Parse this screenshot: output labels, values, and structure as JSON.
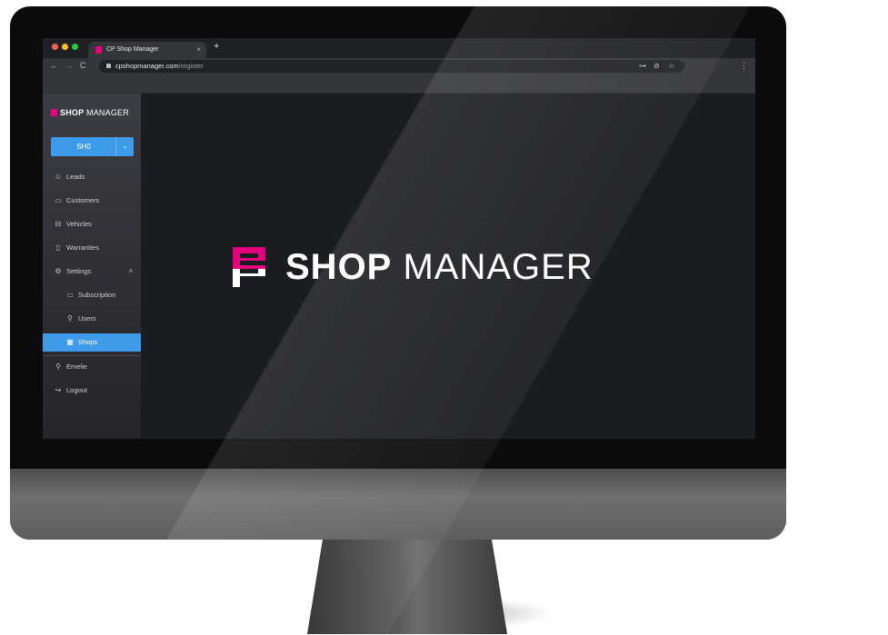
{
  "browser": {
    "tab_title": "CP Shop Manager",
    "tab_close": "×",
    "new_tab": "+",
    "url_host": "cpshopmanager.com",
    "url_path": "/register",
    "nav": {
      "back": "←",
      "forward": "→",
      "reload": "C"
    },
    "url_icons": {
      "key": "⊶",
      "eye_off": "⊘",
      "star": "☆"
    },
    "menu": "⋮"
  },
  "sidebar": {
    "logo_bold": "SHOP",
    "logo_light": " MANAGER",
    "shop_select": {
      "value": "SH0",
      "chevron": "⌄"
    },
    "items": [
      {
        "label": "Leads",
        "icon": "☺"
      },
      {
        "label": "Customers",
        "icon": "▭"
      },
      {
        "label": "Vehicles",
        "icon": "⊟"
      },
      {
        "label": "Warranties",
        "icon": "▯"
      },
      {
        "label": "Settings",
        "icon": "⚙",
        "toggle": "˄"
      },
      {
        "label": "Subscription",
        "icon": "▭"
      },
      {
        "label": "Users",
        "icon": "⚲"
      },
      {
        "label": "Shops",
        "icon": "▦"
      },
      {
        "label": "Emelie",
        "icon": "⚲"
      },
      {
        "label": "Logout",
        "icon": "↪"
      }
    ]
  },
  "main": {
    "logo_bold": "SHOP",
    "logo_light": " MANAGER"
  },
  "colors": {
    "accent": "#3d9be9",
    "brand_pink": "#e6007e"
  }
}
